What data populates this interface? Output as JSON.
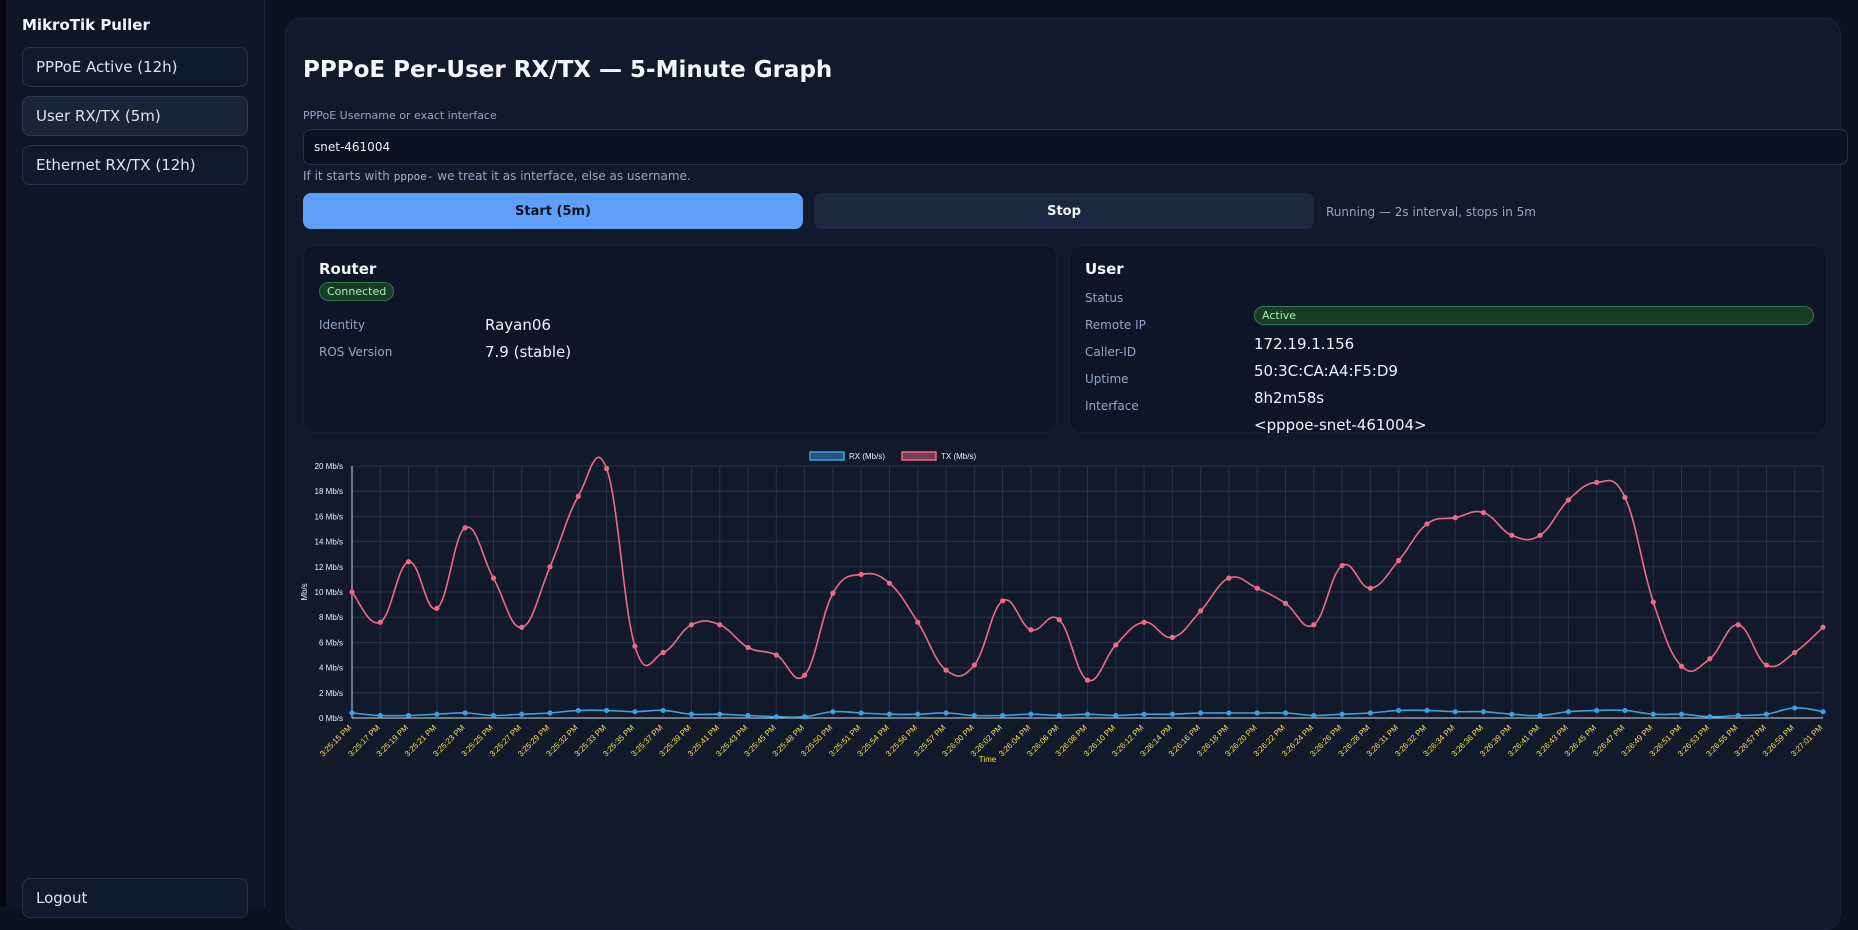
{
  "sidebar": {
    "brand": "MikroTik Puller",
    "items": [
      {
        "label": "PPPoE Active (12h)"
      },
      {
        "label": "User RX/TX (5m)"
      },
      {
        "label": "Ethernet RX/TX (12h)"
      }
    ],
    "logout_label": "Logout"
  },
  "page": {
    "title": "PPPoE Per-User RX/TX — 5-Minute Graph",
    "input_label": "PPPoE Username or exact interface",
    "input_value": "snet-461004",
    "hint_prefix": "If it starts with ",
    "hint_code": "pppoe-",
    "hint_suffix": " we treat it as interface, else as username.",
    "start_label": "Start (5m)",
    "stop_label": "Stop",
    "run_status": "Running — 2s interval, stops in 5m"
  },
  "router": {
    "title": "Router",
    "badge": "Connected",
    "identity_label": "Identity",
    "identity_value": "Rayan06",
    "ros_label": "ROS Version",
    "ros_value": "7.9 (stable)"
  },
  "user": {
    "title": "User",
    "status_label": "Status",
    "status_value": "Active",
    "remote_ip_label": "Remote IP",
    "remote_ip_value": "172.19.1.156",
    "caller_id_label": "Caller-ID",
    "caller_id_value": "50:3C:CA:A4:F5:D9",
    "uptime_label": "Uptime",
    "uptime_value": "8h2m58s",
    "interface_label": "Interface",
    "interface_value": "<pppoe-snet-461004>"
  },
  "colors": {
    "rx": "#3aa0e6",
    "tx": "#ef6a86",
    "tick_x": "#f5e04a",
    "tick_y": "#e8eef8",
    "grid": "#263146"
  },
  "chart_data": {
    "type": "line",
    "xlabel": "Time",
    "ylabel": "Mb/s",
    "ylim": [
      0,
      20
    ],
    "ytick_step": 2,
    "y_unit_suffix": " Mb/s",
    "legend_position": "top-center",
    "grid": true,
    "x": [
      "3:25:15 PM",
      "3:25:17 PM",
      "3:25:19 PM",
      "3:25:21 PM",
      "3:25:23 PM",
      "3:25:25 PM",
      "3:25:27 PM",
      "3:25:29 PM",
      "3:25:32 PM",
      "3:25:33 PM",
      "3:25:35 PM",
      "3:25:37 PM",
      "3:25:39 PM",
      "3:25:41 PM",
      "3:25:43 PM",
      "3:25:45 PM",
      "3:25:48 PM",
      "3:25:50 PM",
      "3:25:51 PM",
      "3:25:54 PM",
      "3:25:56 PM",
      "3:25:57 PM",
      "3:26:00 PM",
      "3:26:02 PM",
      "3:26:04 PM",
      "3:26:06 PM",
      "3:26:08 PM",
      "3:26:10 PM",
      "3:26:12 PM",
      "3:26:14 PM",
      "3:26:16 PM",
      "3:26:18 PM",
      "3:26:20 PM",
      "3:26:22 PM",
      "3:26:24 PM",
      "3:26:26 PM",
      "3:26:28 PM",
      "3:26:31 PM",
      "3:26:32 PM",
      "3:26:34 PM",
      "3:26:36 PM",
      "3:26:39 PM",
      "3:26:41 PM",
      "3:26:43 PM",
      "3:26:45 PM",
      "3:26:47 PM",
      "3:26:49 PM",
      "3:26:51 PM",
      "3:26:53 PM",
      "3:26:55 PM",
      "3:26:57 PM",
      "3:26:59 PM",
      "3:27:01 PM"
    ],
    "series": [
      {
        "name": "RX (Mb/s)",
        "values": [
          0.4,
          0.2,
          0.2,
          0.3,
          0.4,
          0.2,
          0.3,
          0.4,
          0.6,
          0.6,
          0.5,
          0.6,
          0.3,
          0.3,
          0.2,
          0.1,
          0.1,
          0.5,
          0.4,
          0.3,
          0.3,
          0.4,
          0.2,
          0.2,
          0.3,
          0.2,
          0.3,
          0.2,
          0.3,
          0.3,
          0.4,
          0.4,
          0.4,
          0.4,
          0.2,
          0.3,
          0.4,
          0.6,
          0.6,
          0.5,
          0.5,
          0.3,
          0.2,
          0.5,
          0.6,
          0.6,
          0.3,
          0.3,
          0.1,
          0.2,
          0.3,
          0.8,
          0.5
        ]
      },
      {
        "name": "TX (Mb/s)",
        "values": [
          10.0,
          7.6,
          12.4,
          8.7,
          15.1,
          11.1,
          7.2,
          12.0,
          17.6,
          19.8,
          5.7,
          5.2,
          7.4,
          7.4,
          5.6,
          5.0,
          3.4,
          9.9,
          11.4,
          10.7,
          7.6,
          3.8,
          4.2,
          9.3,
          7.0,
          7.8,
          3.0,
          5.8,
          7.6,
          6.4,
          8.5,
          11.1,
          10.3,
          9.1,
          7.4,
          12.1,
          10.3,
          12.5,
          15.4,
          15.9,
          16.3,
          14.5,
          14.5,
          17.3,
          18.7,
          17.5,
          9.2,
          4.1,
          4.7,
          7.4,
          4.2,
          5.2,
          7.2
        ]
      }
    ]
  }
}
